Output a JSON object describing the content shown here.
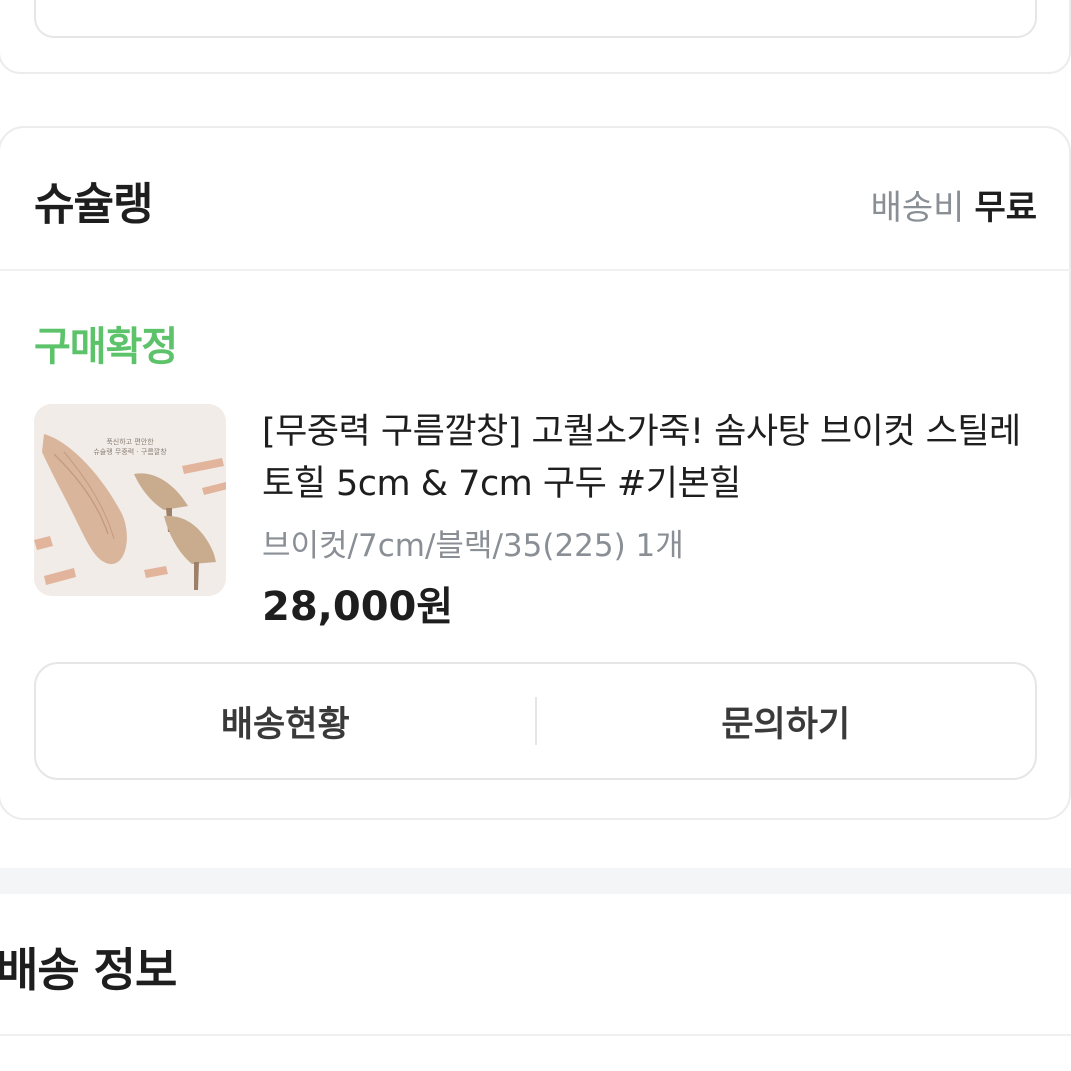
{
  "seller": {
    "name": "슈슐랭",
    "shipping_label": "배송비",
    "shipping_value": "무료"
  },
  "order": {
    "status": "구매확정",
    "status_color": "#5cc36b",
    "product": {
      "title": "[무중력 구름깔창] 고퀄소가죽! 솜사탕 브이컷 스틸레토힐 5cm & 7cm 구두 #기본힐",
      "option": "브이컷/7cm/블랙/35(225) 1개",
      "price": "28,000원",
      "thumbnail_text_line1": "푹신하고 편안한",
      "thumbnail_text_line2": "슈슐랭 무중력 · 구름깔창"
    },
    "actions": {
      "delivery_status": "배송현황",
      "inquiry": "문의하기"
    }
  },
  "delivery_info": {
    "title": "배송 정보"
  }
}
